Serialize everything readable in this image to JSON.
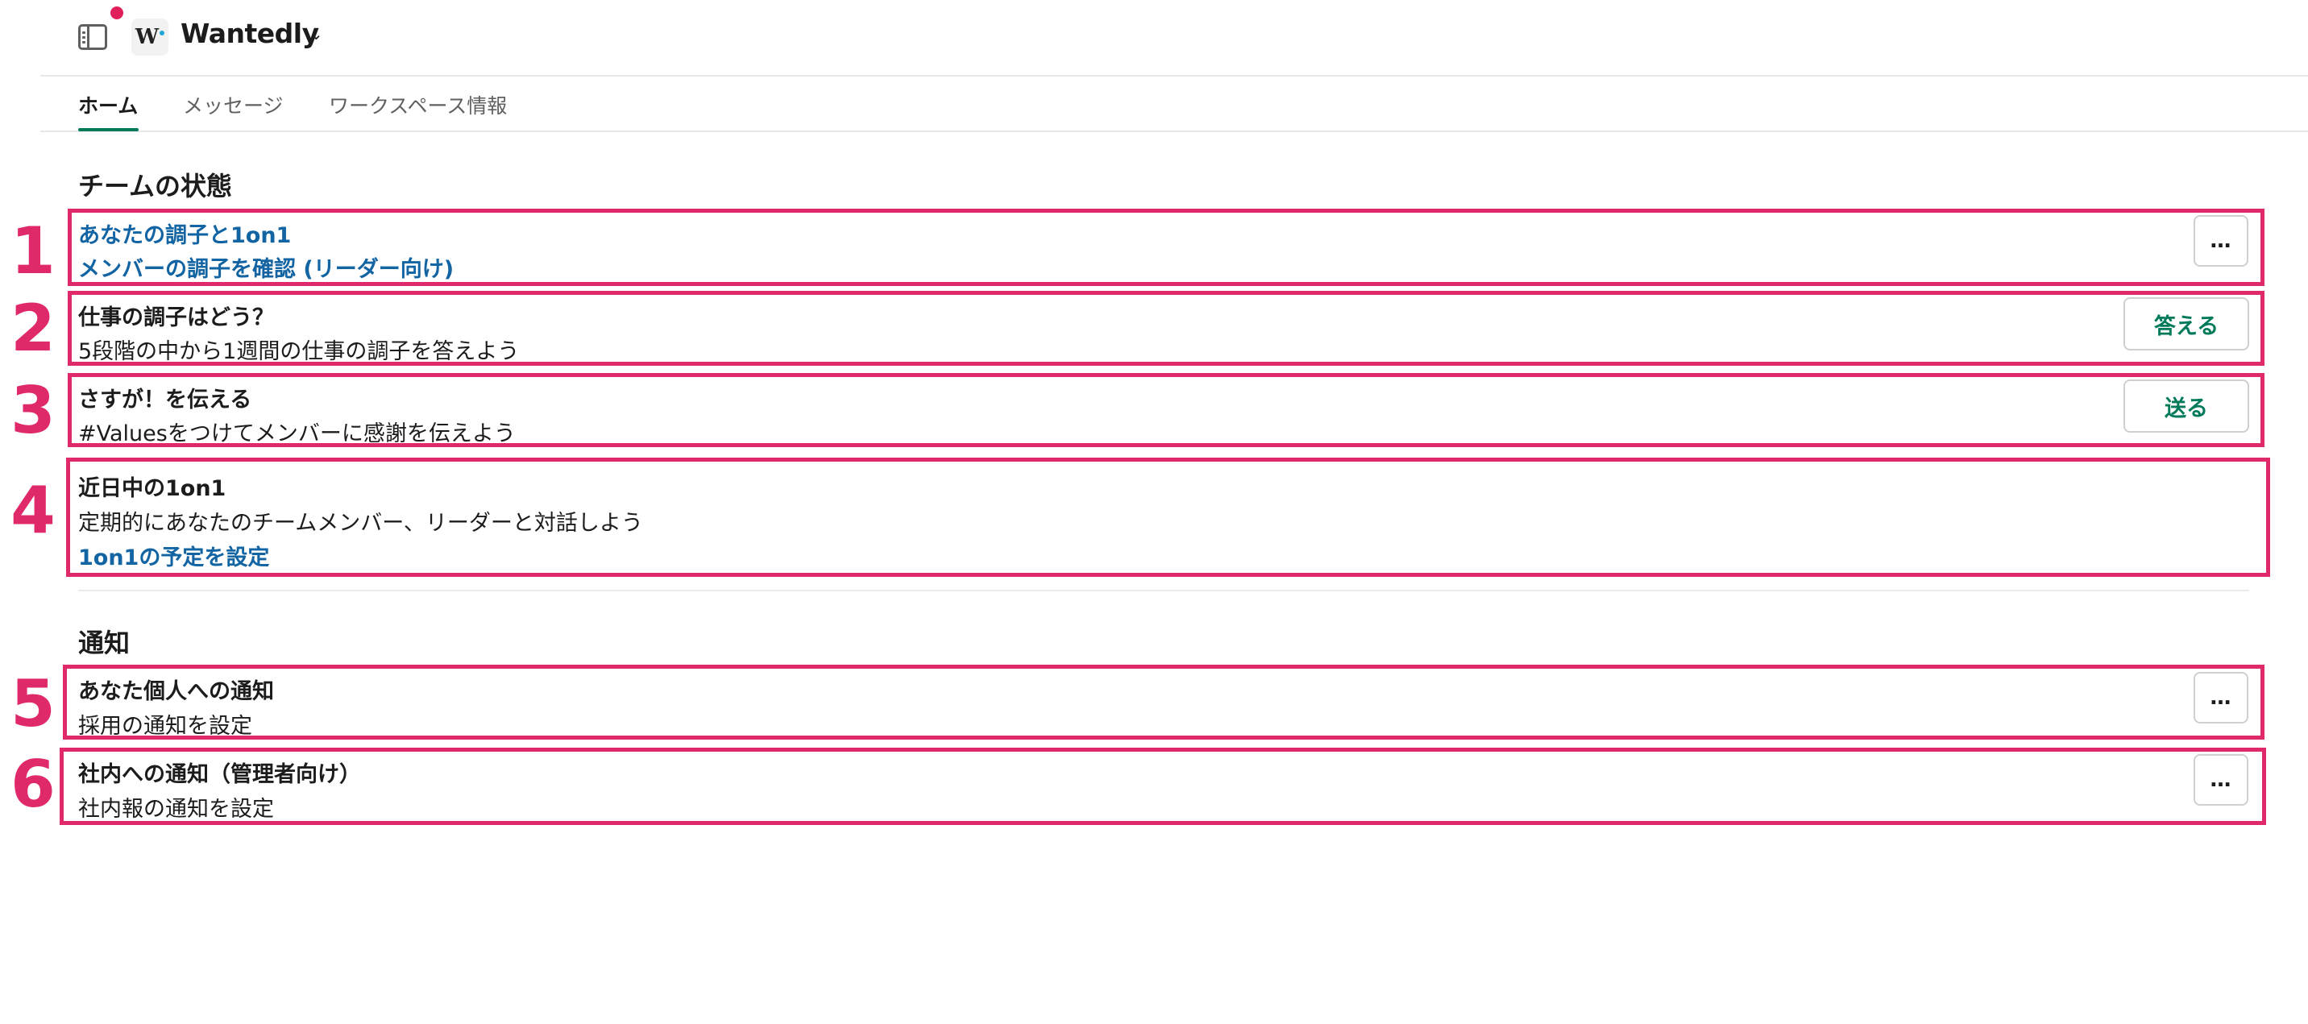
{
  "header": {
    "workspace_name": "Wantedly",
    "logo_letter": "W",
    "caret": "⌄",
    "notification_color": "#e01e5a"
  },
  "tabs": [
    {
      "label": "ホーム",
      "active": true
    },
    {
      "label": "メッセージ",
      "active": false
    },
    {
      "label": "ワークスペース情報",
      "active": false
    }
  ],
  "team_section": {
    "title": "チームの状態",
    "rows": [
      {
        "number": "1",
        "link1": "あなたの調子と1on1",
        "link2": "メンバーの調子を確認 (リーダー向け)",
        "button": "…"
      },
      {
        "number": "2",
        "heading": "仕事の調子はどう？",
        "body": "5段階の中から1週間の仕事の調子を答えよう",
        "button": "答える"
      },
      {
        "number": "3",
        "heading": "さすが！を伝える",
        "body": "#Valuesをつけてメンバーに感謝を伝えよう",
        "button": "送る"
      },
      {
        "number": "4",
        "heading": "近日中の1on1",
        "body": "定期的にあなたのチームメンバー、リーダーと対話しよう",
        "link": "1on1の予定を設定"
      }
    ]
  },
  "notify_section": {
    "title": "通知",
    "rows": [
      {
        "number": "5",
        "heading": "あなた個人への通知",
        "body": "採用の通知を設定",
        "button": "…"
      },
      {
        "number": "6",
        "heading": "社内への通知（管理者向け）",
        "body": "社内報の通知を設定",
        "button": "…"
      }
    ]
  },
  "colors": {
    "highlight": "#e0296a",
    "link": "#1264a3",
    "action": "#007a5a",
    "tab_underline": "#007a5a"
  }
}
